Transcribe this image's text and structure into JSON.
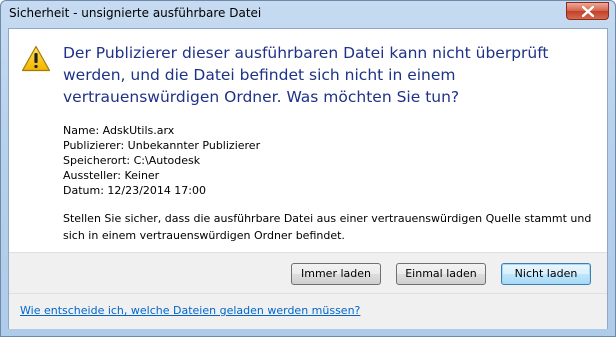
{
  "window": {
    "title": "Sicherheit - unsignierte ausführbare Datei"
  },
  "dialog": {
    "headline": "Der Publizierer dieser ausführbaren Datei kann nicht überprüft werden, und die Datei befindet sich nicht in einem vertrauenswürdigen Ordner. Was möchten Sie tun?",
    "details": {
      "name": "Name: AdskUtils.arx",
      "publisher": "Publizierer: Unbekannter Publizierer",
      "location": "Speicherort: C:\\Autodesk",
      "issuer": "Aussteller: Keiner",
      "date": "Datum: 12/23/2014  17:00"
    },
    "info": "Stellen Sie sicher, dass die ausführbare Datei aus einer vertrauenswürdigen Quelle stammt und sich in einem vertrauenswürdigen Ordner befindet."
  },
  "buttons": {
    "always_load": "Immer laden",
    "load_once": "Einmal laden",
    "do_not_load": "Nicht laden"
  },
  "footer": {
    "help_link": "Wie entscheide ich, welche Dateien geladen werden müssen?"
  },
  "icons": {
    "warning": "warning-icon",
    "close": "close-icon"
  },
  "colors": {
    "headline": "#1e3287",
    "link": "#0066cc",
    "close_button": "#c2402a",
    "warning_fill": "#f5c400"
  }
}
